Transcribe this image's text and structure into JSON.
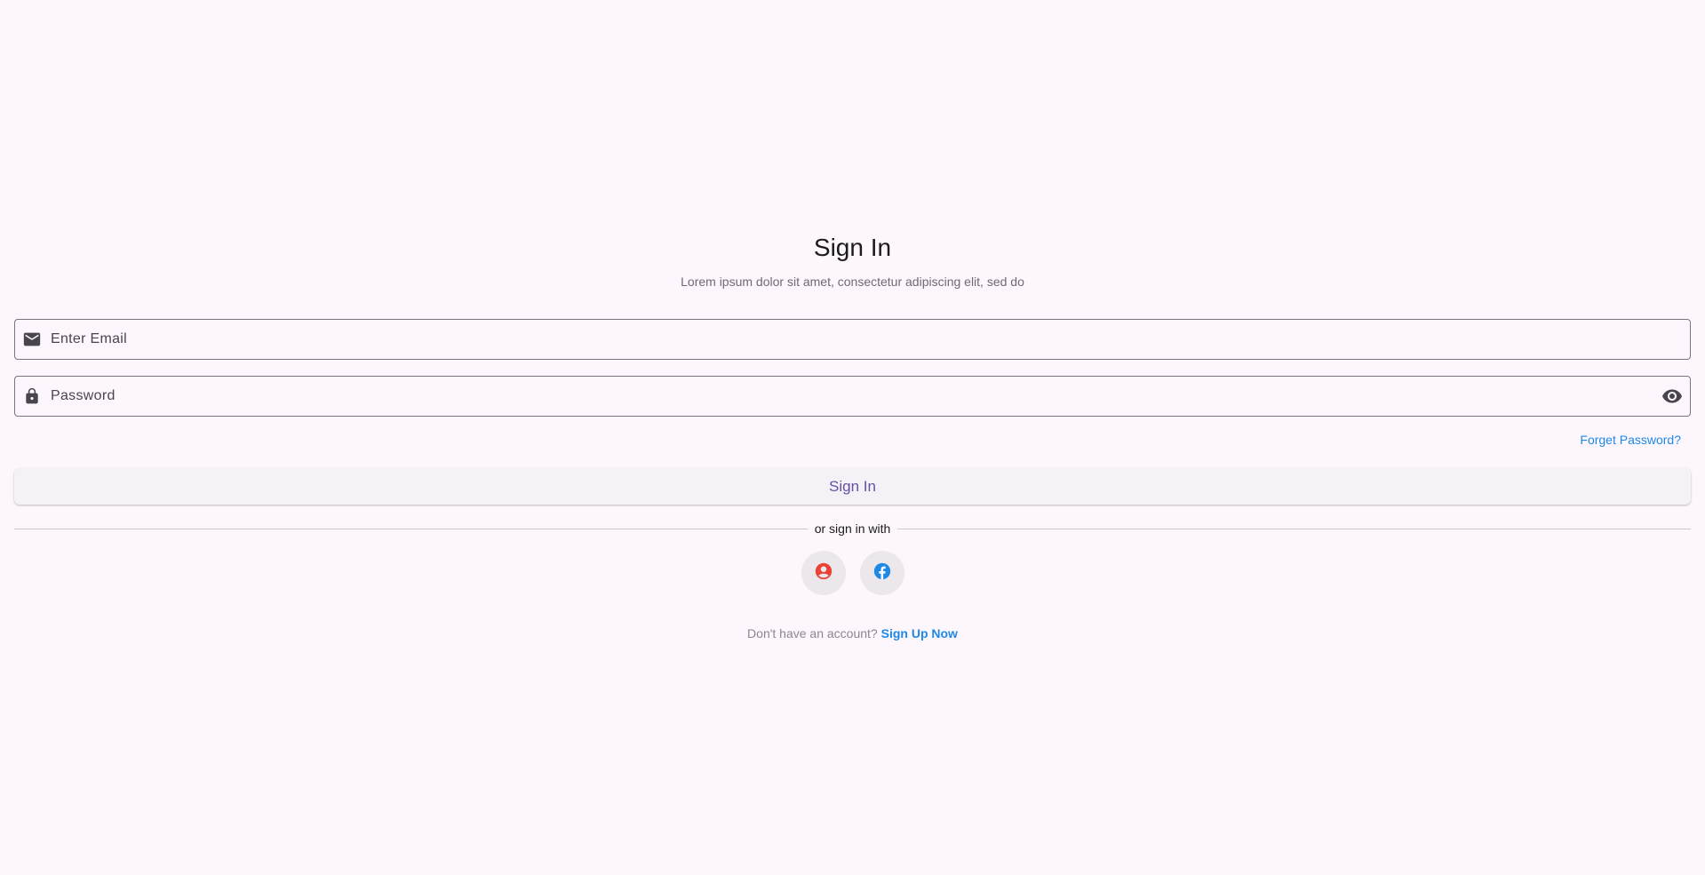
{
  "header": {
    "title": "Sign In",
    "subtitle": "Lorem ipsum dolor sit amet, consectetur adipiscing elit, sed do"
  },
  "form": {
    "email": {
      "placeholder": "Enter Email",
      "value": "",
      "icon": "mail-icon"
    },
    "password": {
      "placeholder": "Password",
      "value": "",
      "icon": "lock-icon",
      "toggle_icon": "eye-icon"
    },
    "forgot_label": "Forget Password?",
    "submit_label": "Sign In"
  },
  "social": {
    "divider_label": "or sign in with",
    "providers": [
      {
        "name": "google",
        "icon": "account-circle-icon",
        "color": "#ea4335"
      },
      {
        "name": "facebook",
        "icon": "facebook-icon",
        "color": "#1e88e5"
      }
    ]
  },
  "footer": {
    "prompt": "Don't have an account?",
    "link_label": "Sign Up Now"
  },
  "colors": {
    "background": "#fdf7fd",
    "accent": "#1e88e5",
    "primary": "#6750a4"
  }
}
